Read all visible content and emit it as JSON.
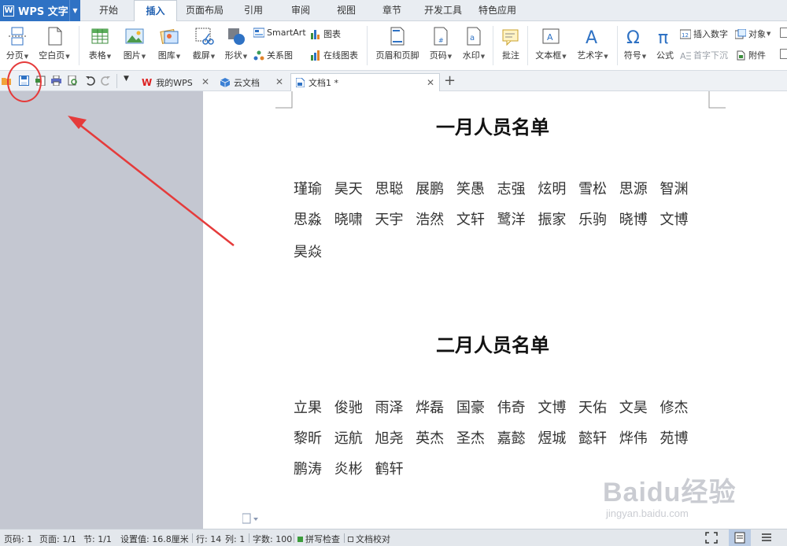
{
  "app": {
    "title": "WPS 文字"
  },
  "menu_tabs": [
    "开始",
    "插入",
    "页面布局",
    "引用",
    "审阅",
    "视图",
    "章节",
    "开发工具",
    "特色应用"
  ],
  "active_menu_tab": "插入",
  "ribbon": {
    "page_break": "分页",
    "blank_page": "空白页",
    "table": "表格",
    "picture": "图片",
    "gallery": "图库",
    "screenshot": "截屏",
    "shape": "形状",
    "smartart": "SmartArt",
    "chart": "图表",
    "relation_chart": "关系图",
    "online_chart": "在线图表",
    "header_footer": "页眉和页脚",
    "page_number": "页码",
    "watermark": "水印",
    "comment": "批注",
    "textbox": "文本框",
    "wordart": "艺术字",
    "symbol": "符号",
    "formula": "公式",
    "insert_number": "插入数字",
    "object": "对象",
    "drop_cap": "首字下沉",
    "attachment": "附件"
  },
  "doc_tabs": [
    {
      "label": "我的WPS"
    },
    {
      "label": "云文档"
    },
    {
      "label": "文档1 *"
    }
  ],
  "document": {
    "heading1": "一月人员名单",
    "list1_lines": [
      "瑾瑜 昊天 思聪 展鹏 笑愚 志强 炫明 雪松 思源 智渊",
      "思淼 晓啸 天宇 浩然 文轩 鹭洋 振家 乐驹 晓博 文博",
      "昊焱"
    ],
    "heading2": "二月人员名单",
    "list2_lines": [
      "立果 俊驰 雨泽 烨磊 国豪 伟奇 文博 天佑 文昊 修杰",
      "黎昕 远航 旭尧 英杰 圣杰 嘉懿 煜城 懿轩 烨伟 苑博",
      "鹏涛 炎彬 鹤轩"
    ]
  },
  "status": {
    "page": "页码: 1",
    "pages": "页面: 1/1",
    "section": "节: 1/1",
    "setting": "设置值: 16.8厘米",
    "row": "行: 14",
    "col": "列: 1",
    "words": "字数: 100",
    "spell": "拼写检查",
    "proof": "文档校对"
  },
  "watermark": {
    "brand": "Baidu经验",
    "url": "jingyan.baidu.com"
  },
  "colors": {
    "accent": "#2f72c4",
    "annotation": "#e53b3b",
    "left_pane": "#c4c7d1"
  }
}
